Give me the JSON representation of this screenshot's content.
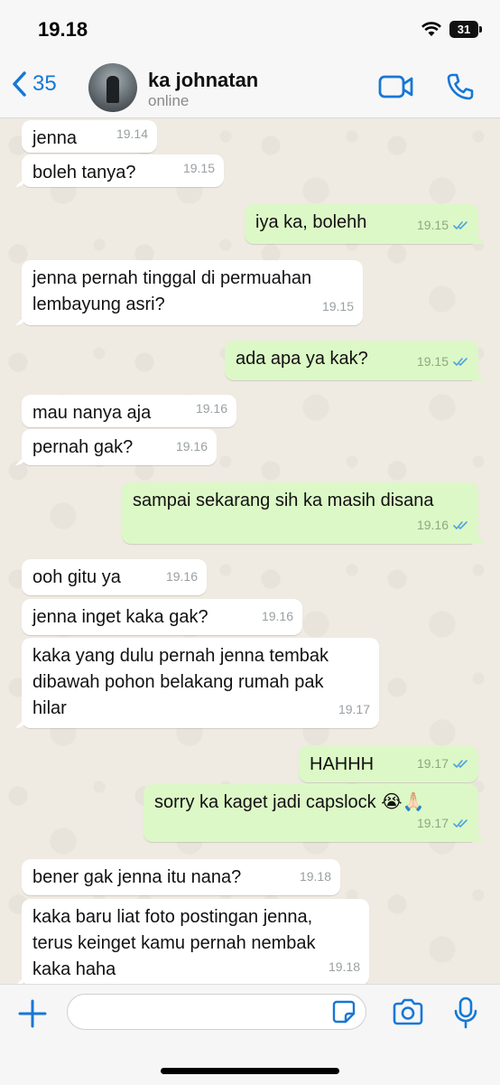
{
  "status_bar": {
    "time": "19.18",
    "battery": "31"
  },
  "header": {
    "back_count": "35",
    "contact_name": "ka johnatan",
    "status": "online"
  },
  "messages": [
    {
      "dir": "in",
      "text": "jenna",
      "time": "19.14"
    },
    {
      "dir": "in",
      "text": "boleh tanya?",
      "time": "19.15"
    },
    {
      "dir": "out",
      "text": "iya ka, bolehh",
      "time": "19.15"
    },
    {
      "dir": "in",
      "text": "jenna pernah tinggal di permuahan\nlembayung asri?",
      "time": "19.15"
    },
    {
      "dir": "out",
      "text": "ada apa ya kak?",
      "time": "19.15"
    },
    {
      "dir": "in",
      "text": "mau nanya aja",
      "time": "19.16"
    },
    {
      "dir": "in",
      "text": "pernah gak?",
      "time": "19.16"
    },
    {
      "dir": "out",
      "text": "sampai sekarang sih ka masih disana",
      "time": "19.16"
    },
    {
      "dir": "in",
      "text": "ooh gitu ya",
      "time": "19.16"
    },
    {
      "dir": "in",
      "text": "jenna inget kaka gak?",
      "time": "19.16"
    },
    {
      "dir": "in",
      "text": "kaka yang dulu pernah jenna tembak\ndibawah pohon belakang rumah pak\nhilar",
      "time": "19.17"
    },
    {
      "dir": "out",
      "text": "HAHHH",
      "time": "19.17"
    },
    {
      "dir": "out",
      "text": "sorry ka kaget jadi capslock 😭🙏🏻",
      "time": "19.17"
    },
    {
      "dir": "in",
      "text": "bener gak jenna itu nana?",
      "time": "19.18"
    },
    {
      "dir": "in",
      "text": "kaka baru liat foto postingan jenna,\nterus keinget kamu pernah nembak\nkaka haha",
      "time": "19.18"
    }
  ],
  "icons": [
    "back-chevron-icon",
    "video-call-icon",
    "phone-icon",
    "plus-icon",
    "sticker-icon",
    "camera-icon",
    "mic-icon",
    "read-ticks-icon"
  ],
  "colors": {
    "accent": "#1677d6",
    "outgoing_bubble": "#dcf8c6",
    "incoming_bubble": "#ffffff",
    "chat_bg": "#efeae2"
  }
}
